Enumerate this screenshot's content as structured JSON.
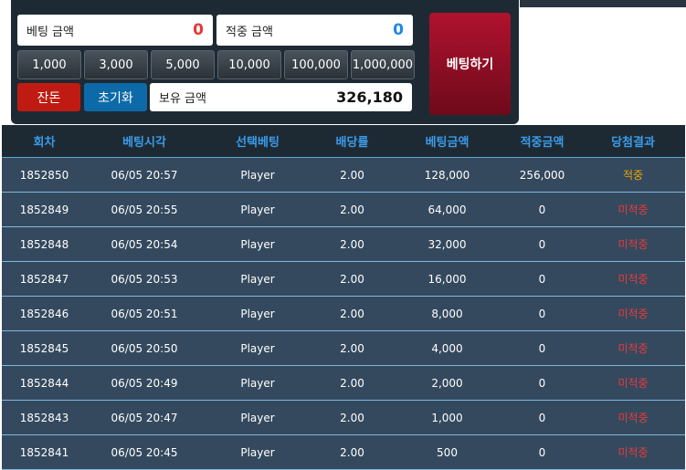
{
  "bet_panel": {
    "bet_amount": {
      "label": "베팅 금액",
      "value": "0"
    },
    "win_amount": {
      "label": "적중 금액",
      "value": "0"
    },
    "chips": [
      "1,000",
      "3,000",
      "5,000",
      "10,000",
      "100,000",
      "1,000,000"
    ],
    "remainder_label": "잔돈",
    "reset_label": "초기화",
    "balance": {
      "label": "보유 금액",
      "value": "326,180"
    },
    "bet_button_label": "베팅하기"
  },
  "history": {
    "columns": [
      "회차",
      "베팅시각",
      "선택베팅",
      "배당률",
      "베팅금액",
      "적중금액",
      "당첨결과"
    ],
    "rows": [
      {
        "round": "1852850",
        "time": "06/05 20:57",
        "choice": "Player",
        "odds": "2.00",
        "bet": "128,000",
        "win": "256,000",
        "result": "적중"
      },
      {
        "round": "1852849",
        "time": "06/05 20:55",
        "choice": "Player",
        "odds": "2.00",
        "bet": "64,000",
        "win": "0",
        "result": "미적중"
      },
      {
        "round": "1852848",
        "time": "06/05 20:54",
        "choice": "Player",
        "odds": "2.00",
        "bet": "32,000",
        "win": "0",
        "result": "미적중"
      },
      {
        "round": "1852847",
        "time": "06/05 20:53",
        "choice": "Player",
        "odds": "2.00",
        "bet": "16,000",
        "win": "0",
        "result": "미적중"
      },
      {
        "round": "1852846",
        "time": "06/05 20:51",
        "choice": "Player",
        "odds": "2.00",
        "bet": "8,000",
        "win": "0",
        "result": "미적중"
      },
      {
        "round": "1852845",
        "time": "06/05 20:50",
        "choice": "Player",
        "odds": "2.00",
        "bet": "4,000",
        "win": "0",
        "result": "미적중"
      },
      {
        "round": "1852844",
        "time": "06/05 20:49",
        "choice": "Player",
        "odds": "2.00",
        "bet": "2,000",
        "win": "0",
        "result": "미적중"
      },
      {
        "round": "1852843",
        "time": "06/05 20:47",
        "choice": "Player",
        "odds": "2.00",
        "bet": "1,000",
        "win": "0",
        "result": "미적중"
      },
      {
        "round": "1852841",
        "time": "06/05 20:45",
        "choice": "Player",
        "odds": "2.00",
        "bet": "500",
        "win": "0",
        "result": "미적중"
      }
    ]
  },
  "colors": {
    "win": "#f0a500",
    "lose": "#e83b3b",
    "header_text": "#3a9bea",
    "row_bg": "#34495e"
  }
}
